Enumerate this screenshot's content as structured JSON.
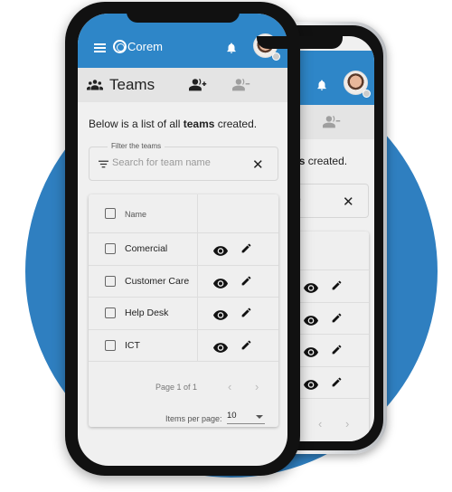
{
  "colors": {
    "brand": "#2e86c8",
    "background_circle": "#2f7fc0"
  },
  "header": {
    "menu_icon": "hamburger-icon",
    "logo_text": "Corem",
    "notification_icon": "bell-icon",
    "avatar": "user-avatar"
  },
  "teams_bar": {
    "title": "Teams",
    "icon": "group-icon",
    "add_icon": "add-user-icon",
    "remove_icon": "remove-user-icon"
  },
  "intro": {
    "prefix": "Below is a list of all ",
    "bold": "teams",
    "suffix": " created."
  },
  "filter": {
    "label": "Filter the teams",
    "placeholder": "Search for team name",
    "value": ""
  },
  "table": {
    "header": "Name",
    "rows": [
      {
        "name": "Comercial"
      },
      {
        "name": "Customer Care"
      },
      {
        "name": "Help Desk"
      },
      {
        "name": "ICT"
      }
    ],
    "page_info": "Page 1 of 1",
    "items_per_page_label": "Items per page:",
    "items_per_page": "10"
  }
}
